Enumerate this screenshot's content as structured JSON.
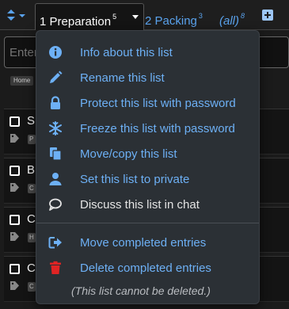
{
  "tabs": [
    {
      "label": "1 Preparation",
      "count": "5"
    },
    {
      "label": "2 Packing",
      "count": "3"
    },
    {
      "label": "(all)",
      "count": "8"
    }
  ],
  "entry_input": {
    "placeholder": "Enter"
  },
  "home_chip": "Home",
  "rows": [
    {
      "text": "S",
      "chip": "P"
    },
    {
      "text": "B",
      "chip": "C"
    },
    {
      "text": "C",
      "chip": "H"
    },
    {
      "text": "C",
      "chip": "C"
    }
  ],
  "menu": {
    "items": [
      {
        "label": "Info about this list",
        "icon": "info-circle-icon"
      },
      {
        "label": "Rename this list",
        "icon": "pencil-icon"
      },
      {
        "label": "Protect this list with password",
        "icon": "lock-icon"
      },
      {
        "label": "Freeze this list with password",
        "icon": "snowflake-icon"
      },
      {
        "label": "Move/copy this list",
        "icon": "copy-icon"
      },
      {
        "label": "Set this list to private",
        "icon": "user-icon"
      },
      {
        "label": "Discuss this list in chat",
        "icon": "chat-bubble-icon"
      },
      {
        "label": "Move completed entries",
        "icon": "share-arrow-icon"
      },
      {
        "label": "Delete completed entries",
        "icon": "trash-icon"
      }
    ],
    "note": "(This list cannot be deleted.)"
  },
  "colors": {
    "accent": "#6db0f5",
    "danger": "#e02424",
    "menu_bg": "#2b3035",
    "page_bg": "#1b1b1b"
  }
}
